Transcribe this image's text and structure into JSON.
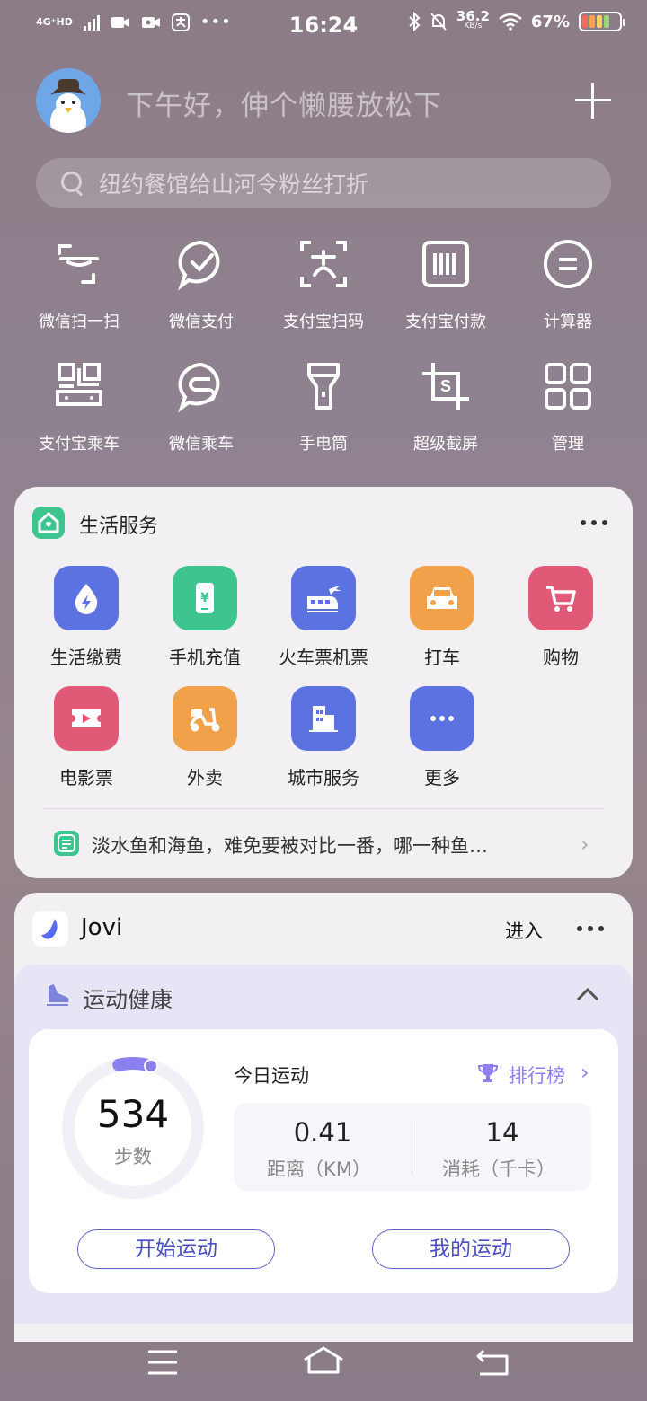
{
  "status_bar": {
    "network": "4G⁺HD",
    "time": "16:24",
    "speed": "36.2",
    "speed_unit": "KB/s",
    "battery": "67%"
  },
  "header": {
    "greeting": "下午好，伸个懒腰放松下"
  },
  "search": {
    "placeholder": "纽约餐馆给山河令粉丝打折"
  },
  "shortcuts": [
    {
      "label": "微信扫一扫",
      "icon": "scan-icon"
    },
    {
      "label": "微信支付",
      "icon": "check-chat-icon"
    },
    {
      "label": "支付宝扫码",
      "icon": "alipay-scan-icon"
    },
    {
      "label": "支付宝付款",
      "icon": "barcode-icon"
    },
    {
      "label": "计算器",
      "icon": "calculator-icon"
    },
    {
      "label": "支付宝乘车",
      "icon": "bus-qr-icon"
    },
    {
      "label": "微信乘车",
      "icon": "wechat-bus-icon"
    },
    {
      "label": "手电筒",
      "icon": "flashlight-icon"
    },
    {
      "label": "超级截屏",
      "icon": "screenshot-icon"
    },
    {
      "label": "管理",
      "icon": "grid-icon"
    }
  ],
  "life_service": {
    "title": "生活服务",
    "items": [
      {
        "label": "生活缴费",
        "icon": "water-bolt-icon",
        "color": "#5b72e0"
      },
      {
        "label": "手机充值",
        "icon": "phone-yuan-icon",
        "color": "#3ec58f"
      },
      {
        "label": "火车票机票",
        "icon": "train-plane-icon",
        "color": "#5b72e0"
      },
      {
        "label": "打车",
        "icon": "car-icon",
        "color": "#f0a14a"
      },
      {
        "label": "购物",
        "icon": "cart-icon",
        "color": "#e05a78"
      },
      {
        "label": "电影票",
        "icon": "ticket-icon",
        "color": "#e05a78"
      },
      {
        "label": "外卖",
        "icon": "scooter-icon",
        "color": "#f0a14a"
      },
      {
        "label": "城市服务",
        "icon": "building-icon",
        "color": "#5b72e0"
      },
      {
        "label": "更多",
        "icon": "more-icon",
        "color": "#5b72e0"
      }
    ],
    "news": "淡水鱼和海鱼，难免要被对比一番，哪一种鱼…"
  },
  "jovi": {
    "title": "Jovi",
    "enter": "进入",
    "health": {
      "title": "运动健康",
      "steps": "534",
      "steps_label": "步数",
      "steps_progress": 0.08,
      "today": "今日运动",
      "rank": "排行榜",
      "distance": "0.41",
      "distance_label": "距离（KM）",
      "calories": "14",
      "calories_label": "消耗（千卡）",
      "start_btn": "开始运动",
      "my_btn": "我的运动"
    }
  }
}
